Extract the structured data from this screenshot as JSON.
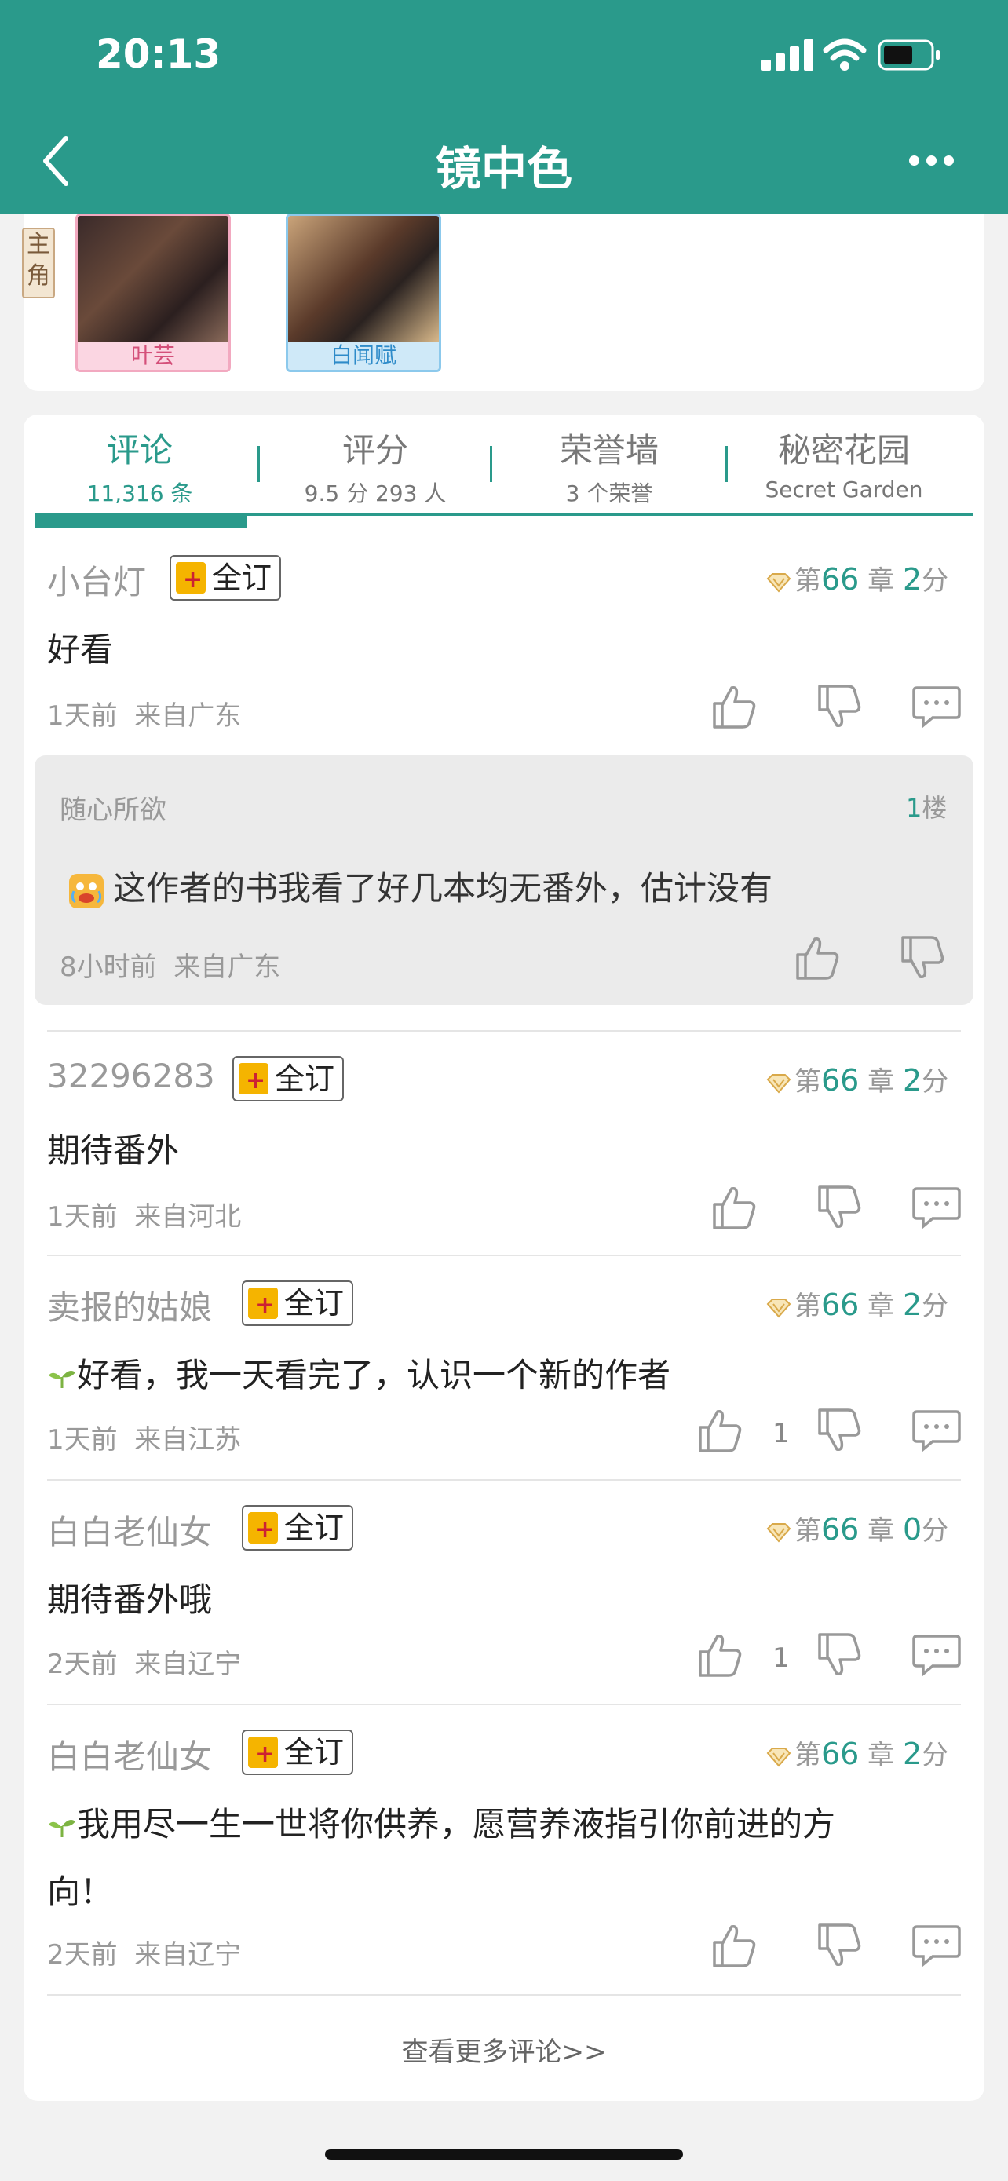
{
  "status_bar": {
    "time": "20:13"
  },
  "header": {
    "title": "镜中色"
  },
  "characters": {
    "role_tag": "主角",
    "items": [
      {
        "name": "叶芸"
      },
      {
        "name": "白闻赋"
      }
    ]
  },
  "tabs": [
    {
      "label": "评论",
      "sub": "11,316 条",
      "active": true
    },
    {
      "label": "评分",
      "sub": "9.5 分 293 人",
      "active": false
    },
    {
      "label": "荣誉墙",
      "sub": "3 个荣誉",
      "active": false
    },
    {
      "label": "秘密花园",
      "sub": "Secret Garden",
      "active": false
    }
  ],
  "comments": [
    {
      "user": "小台灯",
      "badge": "全订",
      "chapter_prefix": "第",
      "chapter": "66",
      "chapter_unit": "章",
      "score": "2",
      "score_unit": "分",
      "text": "好看",
      "time": "1天前",
      "location": "来自广东"
    },
    {
      "user": "32296283",
      "badge": "全订",
      "chapter_prefix": "第",
      "chapter": "66",
      "chapter_unit": "章",
      "score": "2",
      "score_unit": "分",
      "text": "期待番外",
      "time": "1天前",
      "location": "来自河北"
    },
    {
      "user": "卖报的姑娘",
      "badge": "全订",
      "chapter_prefix": "第",
      "chapter": "66",
      "chapter_unit": "章",
      "score": "2",
      "score_unit": "分",
      "text": "好看，我一天看完了，认识一个新的作者",
      "time": "1天前",
      "location": "来自江苏",
      "likes": "1"
    },
    {
      "user": "白白老仙女",
      "badge": "全订",
      "chapter_prefix": "第",
      "chapter": "66",
      "chapter_unit": "章",
      "score": "0",
      "score_unit": "分",
      "text": "期待番外哦",
      "time": "2天前",
      "location": "来自辽宁",
      "likes": "1"
    },
    {
      "user": "白白老仙女",
      "badge": "全订",
      "chapter_prefix": "第",
      "chapter": "66",
      "chapter_unit": "章",
      "score": "2",
      "score_unit": "分",
      "text": "我用尽一生一世将你供养，愿营养液指引你前进的方",
      "text_line2": "向！",
      "time": "2天前",
      "location": "来自辽宁"
    }
  ],
  "reply": {
    "user": "随心所欲",
    "floor": "1楼",
    "text": "这作者的书我看了好几本均无番外，估计没有",
    "time": "8小时前",
    "location": "来自广东"
  },
  "more_comments": "查看更多评论>>",
  "colors": {
    "accent": "#2a9a8b",
    "badge_gold": "#f5b400"
  }
}
